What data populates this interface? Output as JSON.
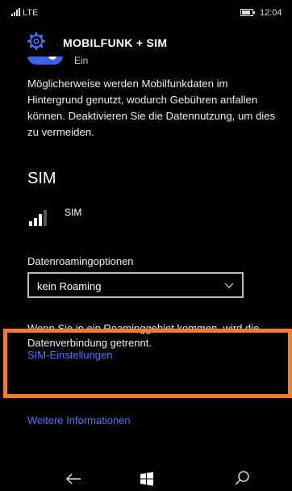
{
  "status_bar": {
    "network": "LTE",
    "time": "12:04"
  },
  "header": {
    "title": "MOBILFUNK + SIM",
    "icon": "gear-icon"
  },
  "data_toggle": {
    "label": "Ein",
    "state": "on"
  },
  "info_text": "Möglicherweise werden Mobilfunkdaten im Hintergrund genutzt, wodurch Gebühren anfallen können. Deaktivieren Sie die Datennutzung, um dies zu vermeiden.",
  "sim_section": {
    "title": "SIM",
    "sim_name": "SIM",
    "roaming_label": "Datenroamingoptionen",
    "roaming_value": "kein Roaming",
    "roaming_info": "Wenn Sie in ein Roaminggebiet kommen, wird die Datenverbindung getrennt.",
    "sim_settings_link": "SIM-Einstellungen",
    "more_info_link": "Weitere Informationen"
  },
  "colors": {
    "accent": "#4f73ff",
    "highlight": "#f07b2a",
    "background": "#000000"
  },
  "nav": {
    "back": "back-arrow-icon",
    "start": "windows-icon",
    "search": "search-icon"
  }
}
